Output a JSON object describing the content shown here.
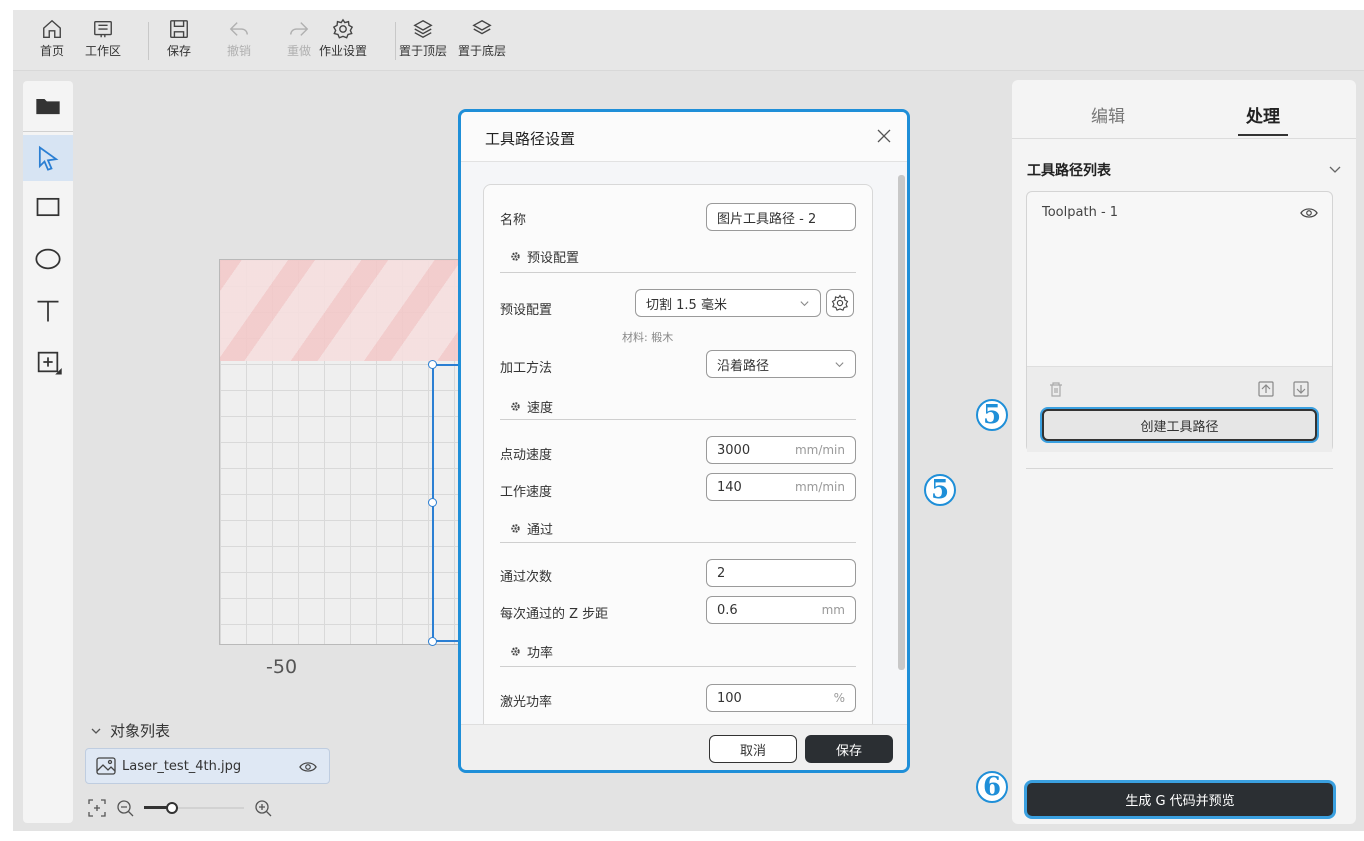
{
  "toolbar": {
    "home": "首页",
    "workspace": "工作区",
    "save": "保存",
    "undo": "撤销",
    "redo": "重做",
    "job_settings": "作业设置",
    "bring_to_front": "置于顶层",
    "send_to_back": "置于底层"
  },
  "canvas": {
    "axis_label": "-50"
  },
  "object_list": {
    "title": "对象列表",
    "items": [
      {
        "name": "Laser_test_4th.jpg"
      }
    ]
  },
  "right_panel": {
    "tabs": [
      "编辑",
      "处理"
    ],
    "active_tab": "处理",
    "toolpath_list_title": "工具路径列表",
    "toolpaths": [
      "Toolpath - 1"
    ],
    "create_toolpath": "创建工具路径",
    "generate_gcode": "生成 G 代码并预览"
  },
  "annotations": {
    "step5": "5",
    "step6": "6",
    "accent_color": "#1f8fd8"
  },
  "dialog": {
    "title": "工具路径设置",
    "name_label": "名称",
    "name_value": "图片工具路径 - 2",
    "preset_section": "预设配置",
    "preset_label": "预设配置",
    "preset_value": "切割 1.5 毫米",
    "material_note": "材料: 椴木",
    "method_label": "加工方法",
    "method_value": "沿着路径",
    "speed_section": "速度",
    "jog_speed_label": "点动速度",
    "jog_speed_value": "3000",
    "jog_speed_unit": "mm/min",
    "work_speed_label": "工作速度",
    "work_speed_value": "140",
    "work_speed_unit": "mm/min",
    "pass_section": "通过",
    "passes_label": "通过次数",
    "passes_value": "2",
    "z_step_label": "每次通过的 Z 步距",
    "z_step_value": "0.6",
    "z_step_unit": "mm",
    "power_section": "功率",
    "laser_power_label": "激光功率",
    "laser_power_value": "100",
    "laser_power_unit": "%",
    "cancel": "取消",
    "save": "保存"
  },
  "zoom": {
    "level": 0.28
  }
}
